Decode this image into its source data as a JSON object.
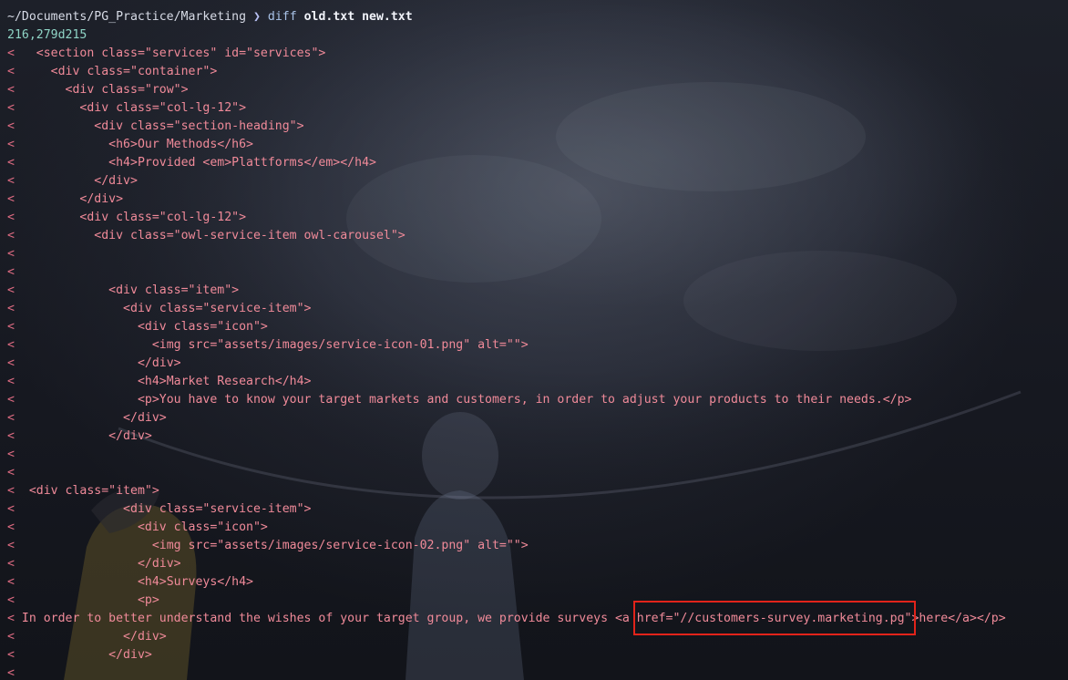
{
  "prompt": {
    "path": "~/Documents/PG_Practice/Marketing",
    "arrow": "❯",
    "command": "diff",
    "args": "old.txt new.txt"
  },
  "hunk_header": "216,279d215",
  "diff_marker": "<",
  "diff_lines": [
    "  <section class=\"services\" id=\"services\">",
    "    <div class=\"container\">",
    "      <div class=\"row\">",
    "        <div class=\"col-lg-12\">",
    "          <div class=\"section-heading\">",
    "            <h6>Our Methods</h6>",
    "            <h4>Provided <em>Plattforms</em></h4>",
    "          </div>",
    "        </div>",
    "        <div class=\"col-lg-12\">",
    "          <div class=\"owl-service-item owl-carousel\">",
    "",
    "",
    "            <div class=\"item\">",
    "              <div class=\"service-item\">",
    "                <div class=\"icon\">",
    "                  <img src=\"assets/images/service-icon-01.png\" alt=\"\">",
    "                </div>",
    "                <h4>Market Research</h4>",
    "                <p>You have to know your target markets and customers, in order to adjust your products to their needs.</p>",
    "              </div>",
    "            </div>",
    "",
    "",
    " <div class=\"item\">",
    "              <div class=\"service-item\">",
    "                <div class=\"icon\">",
    "                  <img src=\"assets/images/service-icon-02.png\" alt=\"\">",
    "                </div>",
    "                <h4>Surveys</h4>",
    "                <p>",
    "In order to better understand the wishes of your target group, we provide surveys <a href=\"//customers-survey.marketing.pg\">here</a></p>",
    "              </div>",
    "            </div>",
    ""
  ],
  "colors": {
    "code_text": "#f08a99",
    "marker": "#e06c83",
    "hunk": "#8fd5c6",
    "highlight_border": "#e2231a"
  }
}
